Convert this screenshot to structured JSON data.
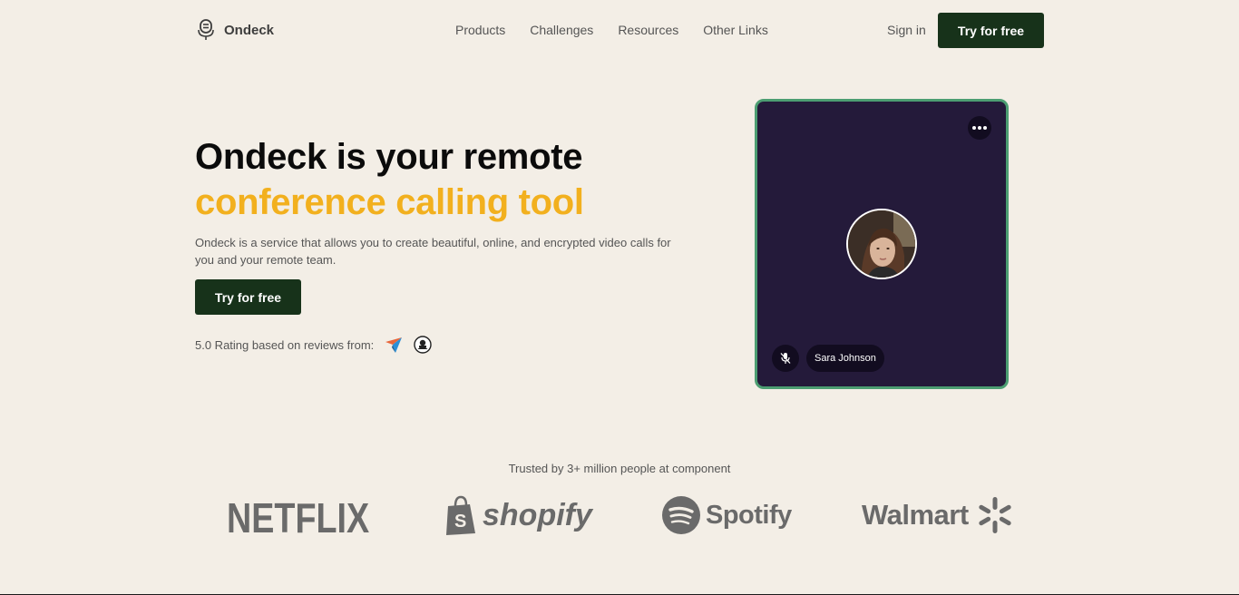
{
  "nav": {
    "brand": "Ondeck",
    "links": [
      "Products",
      "Challenges",
      "Resources",
      "Other Links"
    ],
    "sign_in": "Sign in",
    "cta": "Try for free"
  },
  "hero": {
    "title_line1": "Ondeck is your remote",
    "title_line2": "conference calling tool",
    "description": "Ondeck is a service that allows you to create beautiful, online, and encrypted video calls for you and your remote team.",
    "cta": "Try for free",
    "rating_text": "5.0 Rating based on reviews from:"
  },
  "call": {
    "participant_name": "Sara Johnson",
    "mic_status": "muted"
  },
  "trusted": {
    "text": "Trusted by 3+ million people at component",
    "logos": [
      "NETFLIX",
      "shopify",
      "Spotify",
      "Walmart"
    ]
  },
  "colors": {
    "background": "#f3eee6",
    "accent": "#f2b01e",
    "primary_button": "#17321a",
    "card_bg": "#241a3a",
    "card_border": "#4c9e72"
  }
}
